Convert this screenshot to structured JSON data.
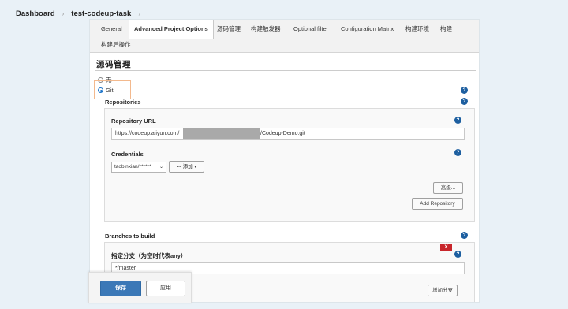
{
  "breadcrumb": {
    "items": [
      "Dashboard",
      "test-codeup-task"
    ],
    "separator": "›"
  },
  "tabs": {
    "items": [
      "General",
      "Advanced Project Options",
      "源码管理",
      "构建触发器",
      "Optional filter",
      "Configuration Matrix",
      "构建环境",
      "构建",
      "构建后操作"
    ],
    "active": "Advanced Project Options"
  },
  "scm": {
    "title": "源码管理",
    "options": [
      "无",
      "Git"
    ],
    "selected": "Git",
    "repositories_label": "Repositories",
    "repository_url_label": "Repository URL",
    "repository_url_prefix": "https://codeup.aliyun.com/",
    "repository_url_suffix": "/Codeup-Demo.git",
    "credentials_label": "Credentials",
    "credentials_value": "taobinxian/******",
    "add_button_label": "添加",
    "advanced_button_label": "高级...",
    "add_repository_label": "Add Repository"
  },
  "branches": {
    "label": "Branches to build",
    "branch_label": "指定分支（为空时代表any）",
    "branch_value": "*/master",
    "delete_label": "X",
    "add_branch_label": "增加分支"
  },
  "footer": {
    "save_label": "保存",
    "apply_label": "应用"
  },
  "help_glyph": "?",
  "colors": {
    "accent": "#3b78b7",
    "help": "#1d5fa0",
    "delete": "#c8262b",
    "highlight": "#f3b98d",
    "background": "#e9f1f7"
  }
}
